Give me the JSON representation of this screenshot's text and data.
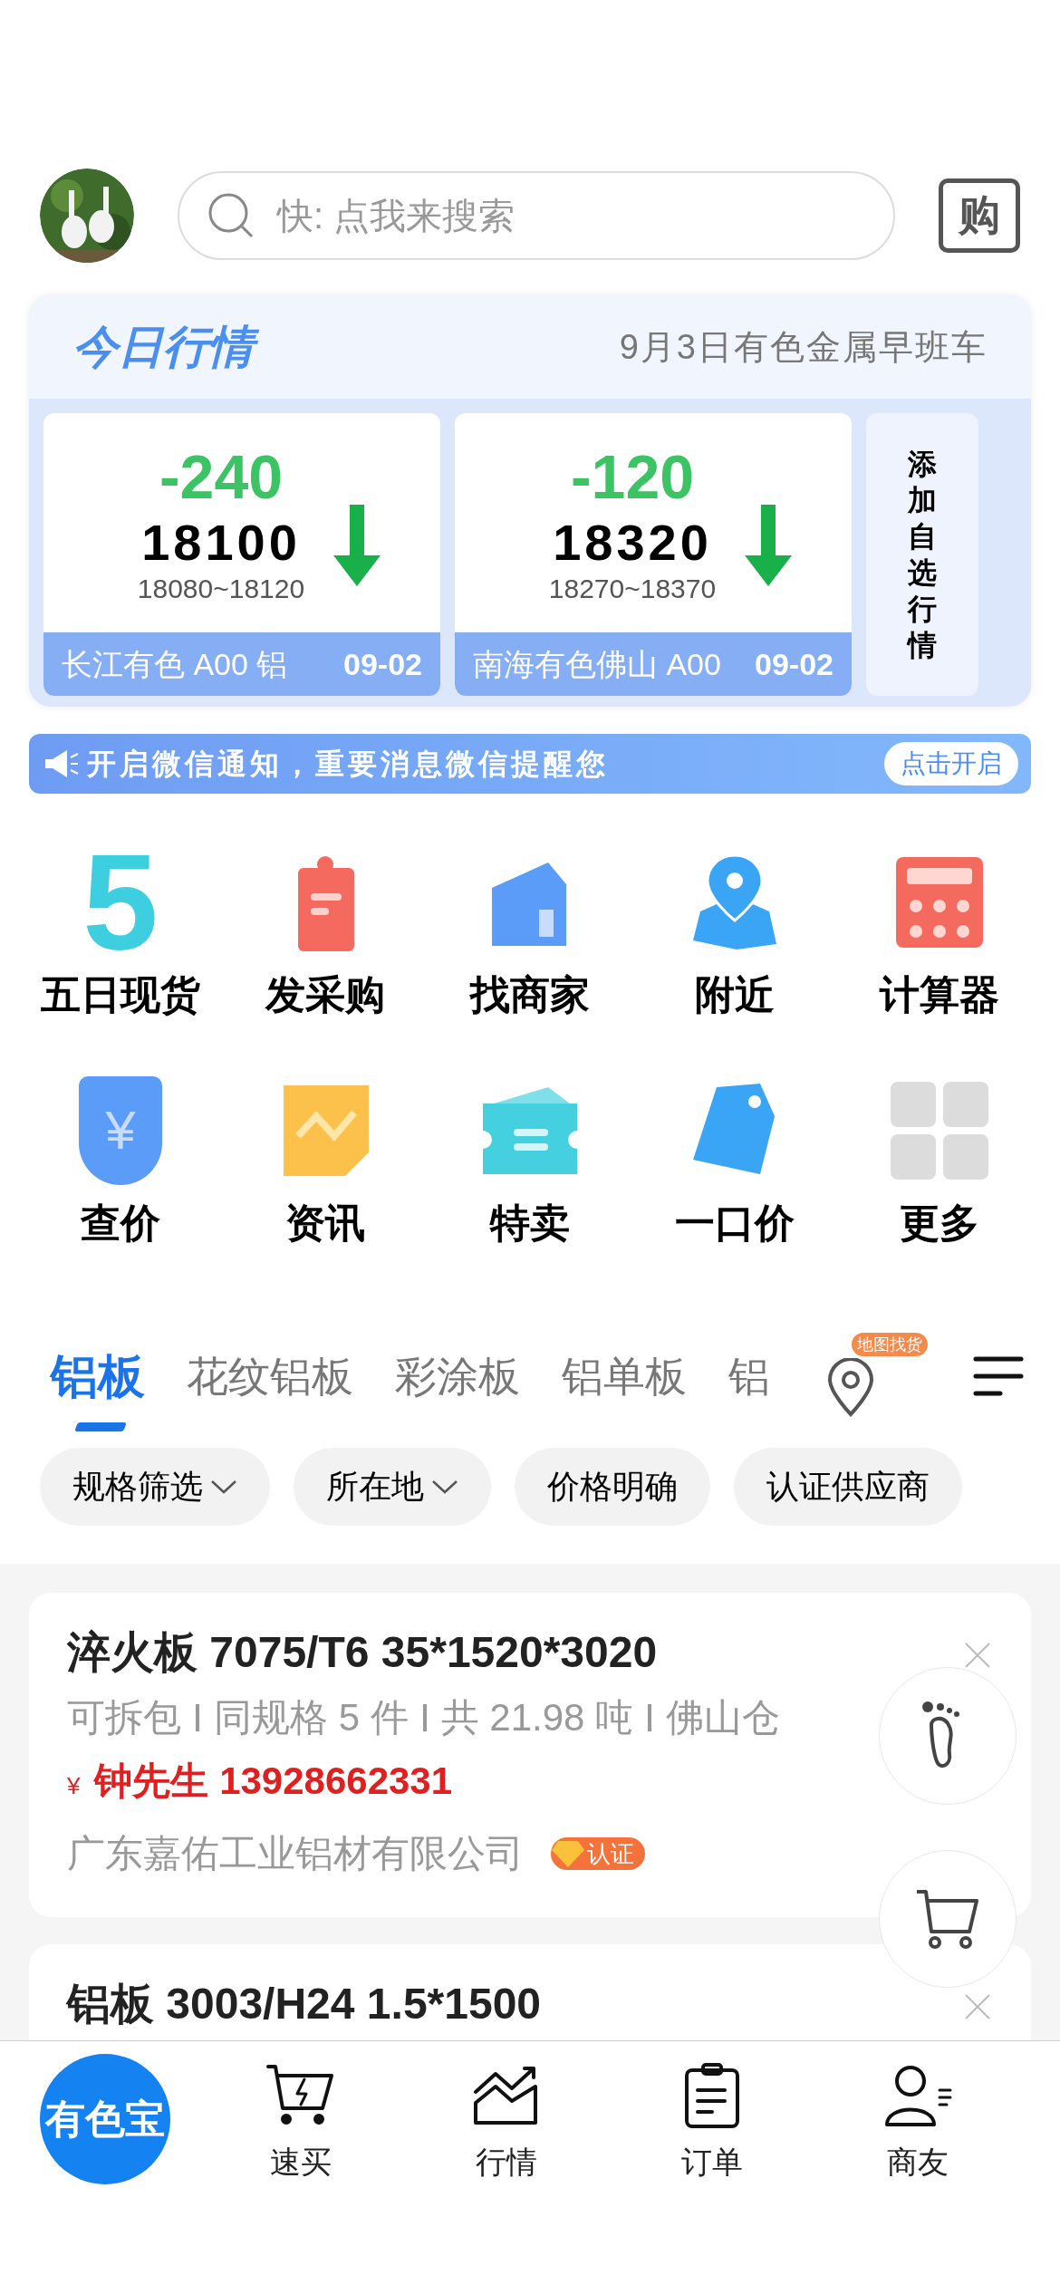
{
  "header": {
    "search_placeholder": "快: 点我来搜索",
    "buy_label": "购"
  },
  "market": {
    "title": "今日行情",
    "subtitle": "9月3日有色金属早班车",
    "quotes": [
      {
        "change": "-240",
        "price": "18100",
        "range": "18080~18120",
        "name": "长江有色 A00 铝",
        "date": "09-02"
      },
      {
        "change": "-120",
        "price": "18320",
        "range": "18270~18370",
        "name": "南海有色佛山 A00",
        "date": "09-02"
      }
    ],
    "add_label": "添加自选行情"
  },
  "notice": {
    "text": "开启微信通知，重要消息微信提醒您",
    "button": "点击开启"
  },
  "shortcuts": [
    {
      "label": "五日现货",
      "icon_text": "5"
    },
    {
      "label": "发采购"
    },
    {
      "label": "找商家"
    },
    {
      "label": "附近"
    },
    {
      "label": "计算器"
    },
    {
      "label": "查价",
      "icon_text": "¥"
    },
    {
      "label": "资讯"
    },
    {
      "label": "特卖"
    },
    {
      "label": "一口价"
    },
    {
      "label": "更多"
    }
  ],
  "category_tabs": [
    {
      "label": "铝板",
      "selected": true
    },
    {
      "label": "花纹铝板",
      "selected": false
    },
    {
      "label": "彩涂板",
      "selected": false
    },
    {
      "label": "铝单板",
      "selected": false
    },
    {
      "label": "铝",
      "selected": false
    }
  ],
  "map_badge": "地图找货",
  "filters": [
    {
      "label": "规格筛选",
      "dropdown": true
    },
    {
      "label": "所在地",
      "dropdown": true
    },
    {
      "label": "价格明确",
      "dropdown": false
    },
    {
      "label": "认证供应商",
      "dropdown": false
    }
  ],
  "listings": [
    {
      "title": "淬火板 7075/T6 35*1520*3020",
      "details": [
        "可拆包",
        "同规格 5 件",
        "共 21.98 吨",
        "佛山仓"
      ],
      "currency": "¥",
      "contact": "钟先生 13928662331",
      "company": "广东嘉佑工业铝材有限公司",
      "certified": true,
      "badge": "认证"
    },
    {
      "title": "铝板 3003/H24 1.5*1500"
    }
  ],
  "bottom_nav": {
    "logo": "有色宝",
    "items": [
      {
        "label": "速买"
      },
      {
        "label": "行情"
      },
      {
        "label": "订单"
      },
      {
        "label": "商友"
      }
    ]
  }
}
